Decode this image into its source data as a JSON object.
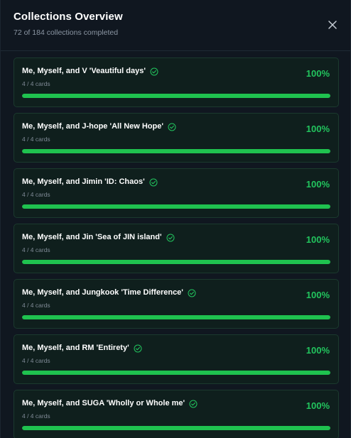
{
  "header": {
    "title": "Collections Overview",
    "subtitle": "72 of 184 collections completed"
  },
  "colors": {
    "accent_green": "#22c55e",
    "bar_fill": "#1fc24f",
    "card_bg": "#0f1f1d",
    "card_border": "#1b3a2e"
  },
  "icons": {
    "close": "close-icon",
    "check": "check-circle-icon"
  },
  "collections": [
    {
      "name": "Me, Myself, and V 'Veautiful days'",
      "count": "4 / 4 cards",
      "percent_label": "100%",
      "progress": 1.0
    },
    {
      "name": "Me, Myself, and J-hope 'All New Hope'",
      "count": "4 / 4 cards",
      "percent_label": "100%",
      "progress": 1.0
    },
    {
      "name": "Me, Myself, and Jimin 'ID: Chaos'",
      "count": "4 / 4 cards",
      "percent_label": "100%",
      "progress": 1.0
    },
    {
      "name": "Me, Myself, and Jin 'Sea of JIN island'",
      "count": "4 / 4 cards",
      "percent_label": "100%",
      "progress": 1.0
    },
    {
      "name": "Me, Myself, and Jungkook 'Time Difference'",
      "count": "4 / 4 cards",
      "percent_label": "100%",
      "progress": 1.0
    },
    {
      "name": "Me, Myself, and RM 'Entirety'",
      "count": "4 / 4 cards",
      "percent_label": "100%",
      "progress": 1.0
    },
    {
      "name": "Me, Myself, and SUGA 'Wholly or Whole me'",
      "count": "4 / 4 cards",
      "percent_label": "100%",
      "progress": 1.0
    }
  ]
}
